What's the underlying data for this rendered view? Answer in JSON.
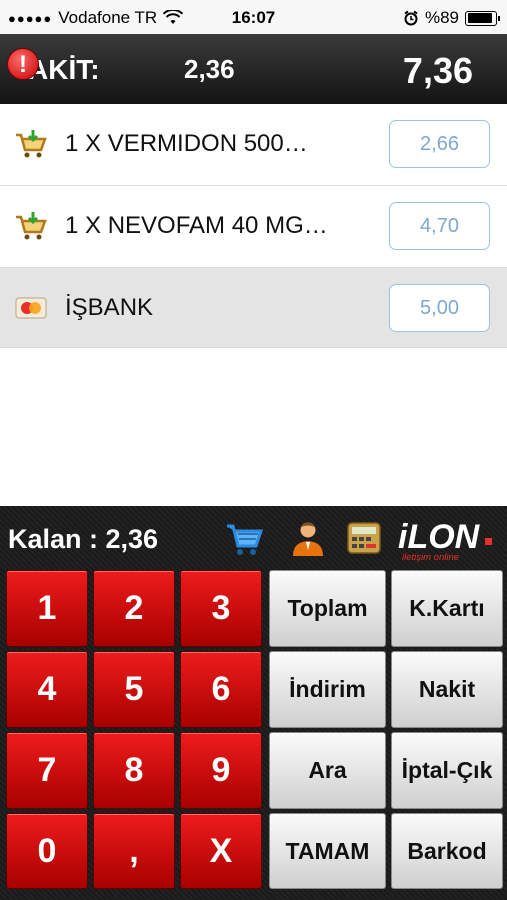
{
  "status_bar": {
    "carrier": "Vodafone TR",
    "time": "16:07",
    "battery": "%89"
  },
  "header": {
    "alert_symbol": "!",
    "label": "AKİT:",
    "amount": "2,36",
    "total": "7,36"
  },
  "items": [
    {
      "icon": "cart-add-icon",
      "text": "1 X VERMIDON 500…",
      "amount": "2,66",
      "type": "product"
    },
    {
      "icon": "cart-add-icon",
      "text": "1 X NEVOFAM 40 MG…",
      "amount": "4,70",
      "type": "product"
    },
    {
      "icon": "credit-card-icon",
      "text": "İŞBANK",
      "amount": "5,00",
      "type": "payment"
    }
  ],
  "panel": {
    "remaining_label": "Kalan : 2,36",
    "logo_text": "iLON",
    "logo_sub": "iletişim online"
  },
  "keypad": {
    "numbers": [
      "1",
      "2",
      "3",
      "4",
      "5",
      "6",
      "7",
      "8",
      "9",
      "0",
      ",",
      "X"
    ],
    "functions": [
      "Toplam",
      "K.Kartı",
      "İndirim",
      "Nakit",
      "Ara",
      "İptal-Çık",
      "TAMAM",
      "Barkod"
    ]
  },
  "colors": {
    "header_bg": "#1e1e1e",
    "number_key": "#d00000",
    "amount_border": "#9cc3e6",
    "amount_text": "#7fa8cf"
  }
}
